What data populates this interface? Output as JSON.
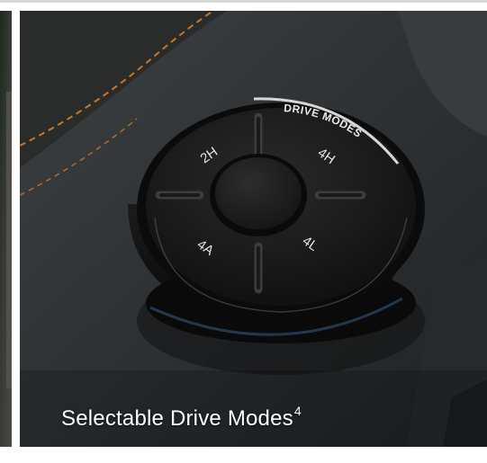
{
  "caption": {
    "text": "Selectable Drive Modes",
    "footnote": "4"
  },
  "dial": {
    "ring_label": "DRIVE MODES",
    "modes": [
      "2H",
      "4H",
      "4A",
      "4L"
    ]
  },
  "colors": {
    "accent_stitching": "#c9761f",
    "caption_text": "#ffffff",
    "dial_body": "#141414"
  }
}
